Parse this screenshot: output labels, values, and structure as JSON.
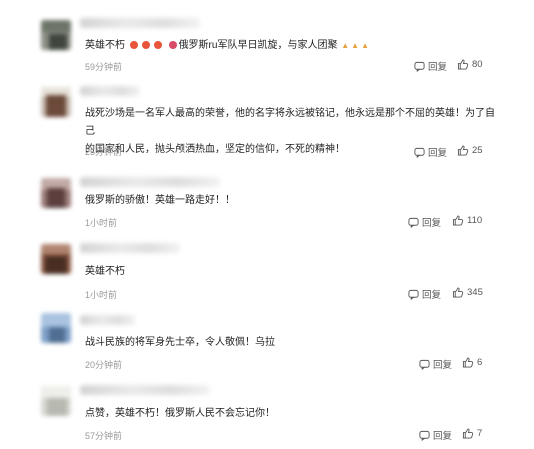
{
  "comments": [
    {
      "text_pre": "英雄不朽",
      "text_mid": "俄罗斯ru军队早日凯旋，与家人团聚",
      "time": "59分钟前",
      "reply_label": "回复",
      "likes": "80"
    },
    {
      "line1": "战死沙场是一名军人最高的荣誉，他的名字将永远被铭记，他永远是那个不屈的英雄！为了自己",
      "line2": "的国家和人民，抛头颅洒热血，坚定的信仰，不死的精神！",
      "time": "25分钟前",
      "reply_label": "回复",
      "likes": "25"
    },
    {
      "text": "俄罗斯的骄傲！英雄一路走好！！",
      "time": "1小时前",
      "reply_label": "回复",
      "likes": "110"
    },
    {
      "text": "英雄不朽",
      "time": "1小时前",
      "reply_label": "回复",
      "likes": "345"
    },
    {
      "text": "战斗民族的将军身先士卒，令人敬佩！乌拉",
      "time": "20分钟前",
      "reply_label": "回复",
      "likes": "6"
    },
    {
      "text": "点赞，英雄不朽！俄罗斯人民不会忘记你！",
      "time": "57分钟前",
      "reply_label": "回复",
      "likes": "7"
    }
  ],
  "icons": {
    "reply": "comment-bubble-icon",
    "like": "thumbs-up-icon"
  },
  "colors": {
    "time": "#999999",
    "text": "#222222",
    "emoji": "#e8553b",
    "flag": "#d84a66",
    "pray": "#e6a23c"
  }
}
